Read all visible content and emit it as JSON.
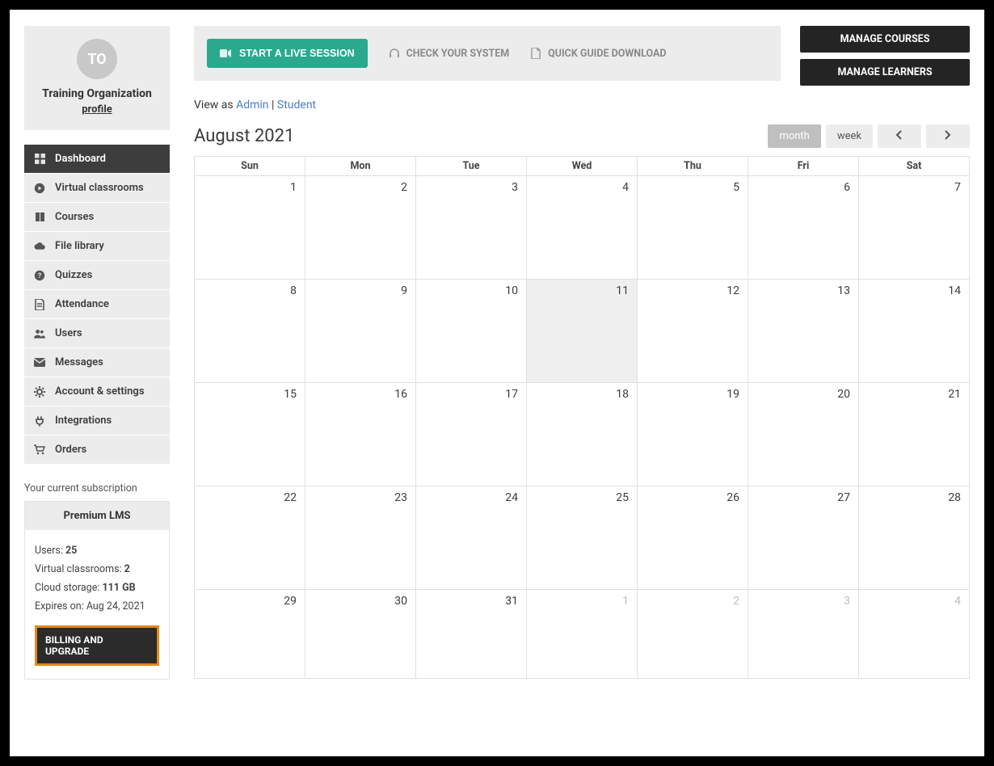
{
  "profile": {
    "avatar_initials": "TO",
    "org_name": "Training Organization",
    "profile_link": "profile"
  },
  "nav": [
    {
      "icon": "grid",
      "label": "Dashboard",
      "active": true
    },
    {
      "icon": "play-circle",
      "label": "Virtual classrooms"
    },
    {
      "icon": "book",
      "label": "Courses"
    },
    {
      "icon": "cloud",
      "label": "File library"
    },
    {
      "icon": "question",
      "label": "Quizzes"
    },
    {
      "icon": "file",
      "label": "Attendance"
    },
    {
      "icon": "users",
      "label": "Users"
    },
    {
      "icon": "mail",
      "label": "Messages"
    },
    {
      "icon": "gear",
      "label": "Account & settings"
    },
    {
      "icon": "plug",
      "label": "Integrations"
    },
    {
      "icon": "cart",
      "label": "Orders"
    }
  ],
  "subscription": {
    "label": "Your current subscription",
    "plan": "Premium LMS",
    "users_label": "Users: ",
    "users_value": "25",
    "vc_label": "Virtual classrooms: ",
    "vc_value": "2",
    "storage_label": "Cloud storage: ",
    "storage_value": "111 GB",
    "expires_label": "Expires on: ",
    "expires_value": "Aug 24, 2021",
    "billing_btn": "BILLING AND UPGRADE"
  },
  "topbar": {
    "live_btn": "START A LIVE SESSION",
    "check_system": "CHECK YOUR SYSTEM",
    "quick_guide": "QUICK GUIDE DOWNLOAD",
    "manage_courses": "MANAGE COURSES",
    "manage_learners": "MANAGE LEARNERS"
  },
  "view_as": {
    "prefix": "View as ",
    "admin": "Admin",
    "sep": " | ",
    "student": "Student"
  },
  "calendar": {
    "title": "August 2021",
    "controls": {
      "month": "month",
      "week": "week"
    },
    "days": [
      "Sun",
      "Mon",
      "Tue",
      "Wed",
      "Thu",
      "Fri",
      "Sat"
    ],
    "weeks": [
      [
        {
          "n": "1"
        },
        {
          "n": "2"
        },
        {
          "n": "3"
        },
        {
          "n": "4"
        },
        {
          "n": "5"
        },
        {
          "n": "6"
        },
        {
          "n": "7"
        }
      ],
      [
        {
          "n": "8"
        },
        {
          "n": "9"
        },
        {
          "n": "10"
        },
        {
          "n": "11",
          "today": true
        },
        {
          "n": "12"
        },
        {
          "n": "13"
        },
        {
          "n": "14"
        }
      ],
      [
        {
          "n": "15"
        },
        {
          "n": "16"
        },
        {
          "n": "17"
        },
        {
          "n": "18"
        },
        {
          "n": "19"
        },
        {
          "n": "20"
        },
        {
          "n": "21"
        }
      ],
      [
        {
          "n": "22"
        },
        {
          "n": "23"
        },
        {
          "n": "24"
        },
        {
          "n": "25"
        },
        {
          "n": "26"
        },
        {
          "n": "27"
        },
        {
          "n": "28"
        }
      ],
      [
        {
          "n": "29"
        },
        {
          "n": "30"
        },
        {
          "n": "31"
        },
        {
          "n": "1",
          "muted": true
        },
        {
          "n": "2",
          "muted": true
        },
        {
          "n": "3",
          "muted": true
        },
        {
          "n": "4",
          "muted": true
        }
      ]
    ]
  }
}
